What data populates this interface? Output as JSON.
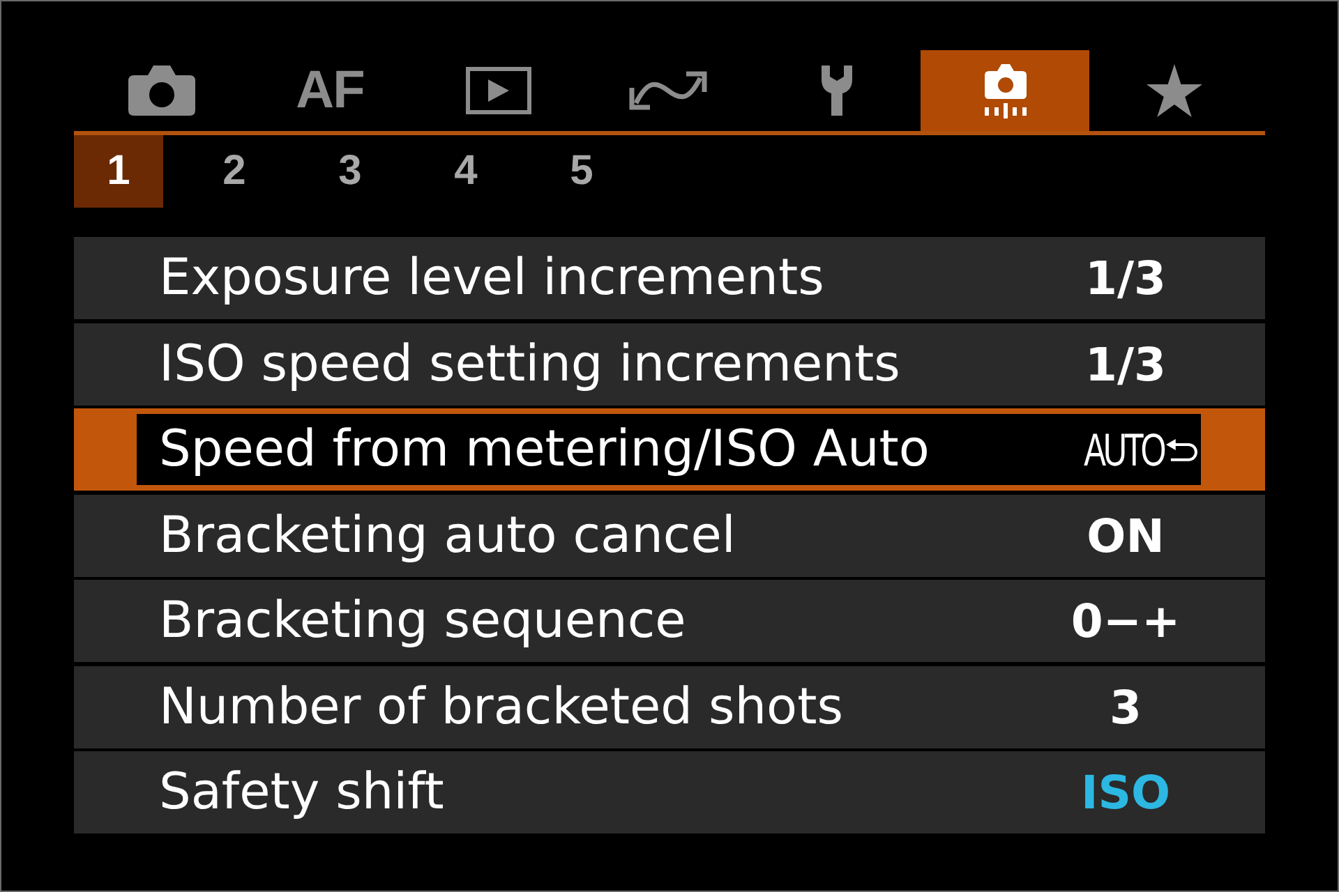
{
  "tabs": [
    {
      "kind": "camera",
      "selected": false
    },
    {
      "kind": "text",
      "label": "AF",
      "selected": false
    },
    {
      "kind": "playback",
      "selected": false
    },
    {
      "kind": "wave",
      "selected": false
    },
    {
      "kind": "wrench",
      "selected": false
    },
    {
      "kind": "custom",
      "selected": true
    },
    {
      "kind": "star",
      "selected": false
    }
  ],
  "pages": [
    {
      "label": "1",
      "selected": true
    },
    {
      "label": "2",
      "selected": false
    },
    {
      "label": "3",
      "selected": false
    },
    {
      "label": "4",
      "selected": false
    },
    {
      "label": "5",
      "selected": false
    }
  ],
  "items": [
    {
      "label": "Exposure level increments",
      "value": "1/3",
      "kind": "text",
      "color": "#ffffff",
      "selected": false
    },
    {
      "label": "ISO speed setting increments",
      "value": "1/3",
      "kind": "text",
      "color": "#ffffff",
      "selected": false
    },
    {
      "label": "Speed from metering/ISO Auto",
      "value": "AUTO",
      "kind": "return",
      "color": "#ffffff",
      "selected": true
    },
    {
      "label": "Bracketing auto cancel",
      "value": "ON",
      "kind": "text",
      "color": "#ffffff",
      "selected": false
    },
    {
      "label": "Bracketing sequence",
      "value": "0−+",
      "kind": "text",
      "color": "#ffffff",
      "selected": false
    },
    {
      "label": "Number of bracketed shots",
      "value": "3",
      "kind": "text",
      "color": "#ffffff",
      "selected": false
    },
    {
      "label": "Safety shift",
      "value": "ISO",
      "kind": "text",
      "color": "#2cb8e2",
      "selected": false
    }
  ]
}
